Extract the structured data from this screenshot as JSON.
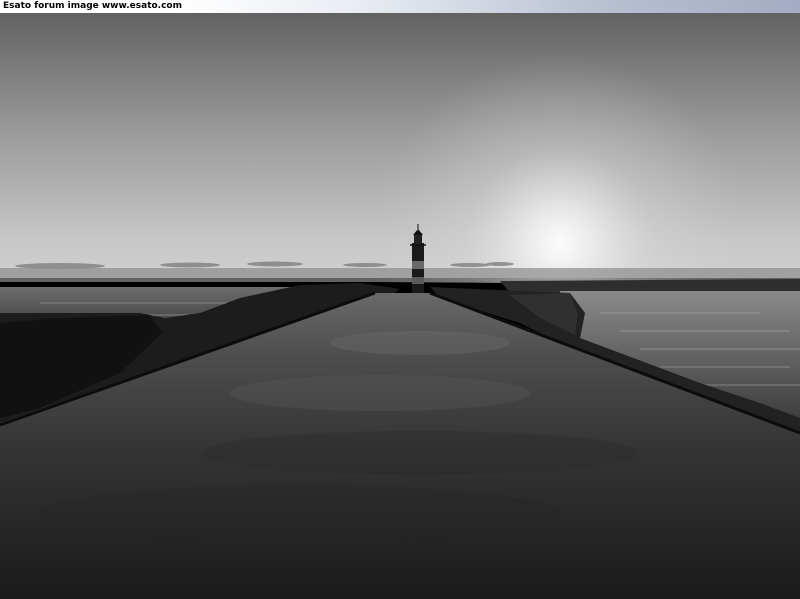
{
  "header": {
    "caption": "Esato forum image www.esato.com"
  },
  "photo": {
    "subject": "pier-lighthouse-sunset",
    "tone": "grayscale"
  }
}
